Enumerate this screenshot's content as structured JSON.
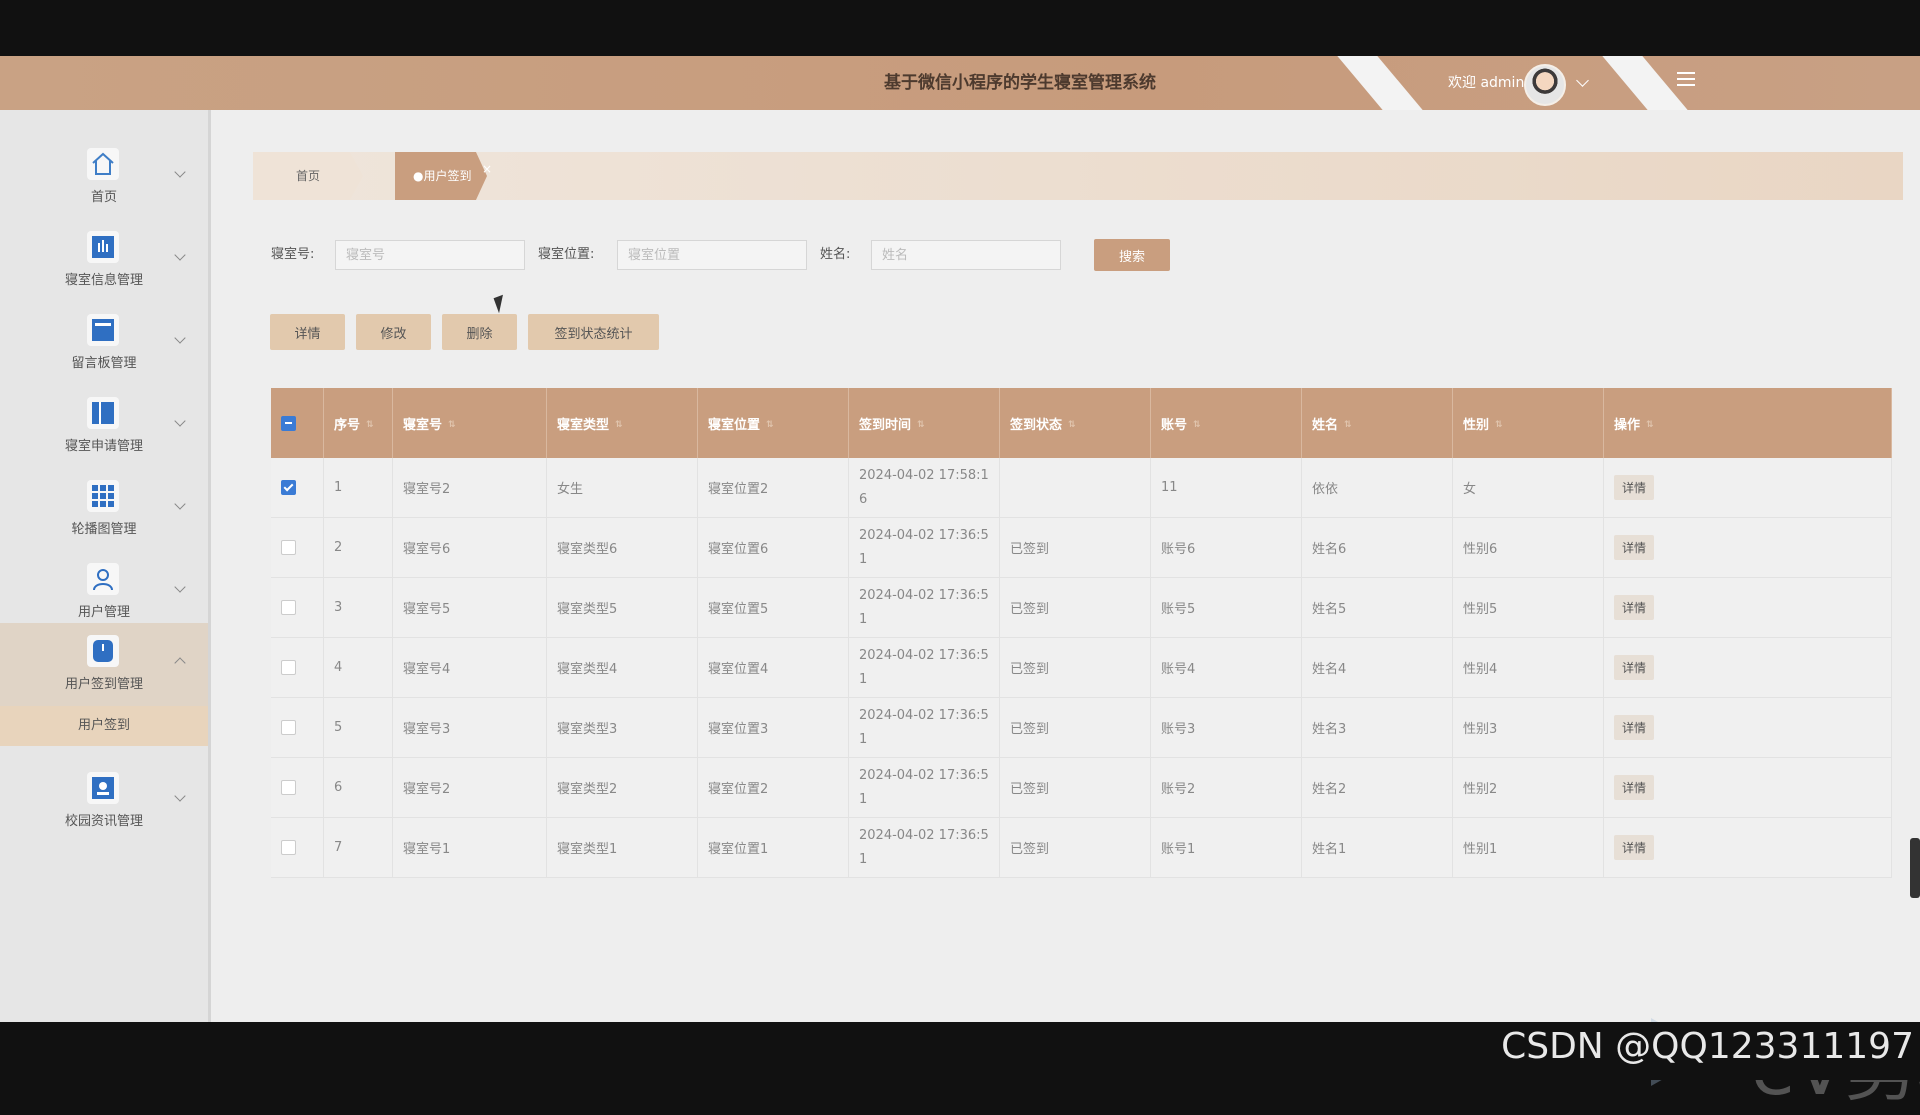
{
  "header": {
    "title": "基于微信小程序的学生寝室管理系统",
    "welcome": "欢迎 admin"
  },
  "sidebar": {
    "items": [
      {
        "label": "首页",
        "icon": "home-icon"
      },
      {
        "label": "寝室信息管理",
        "icon": "info-icon"
      },
      {
        "label": "留言板管理",
        "icon": "board-icon"
      },
      {
        "label": "寝室申请管理",
        "icon": "apply-icon"
      },
      {
        "label": "轮播图管理",
        "icon": "grid-icon"
      },
      {
        "label": "用户管理",
        "icon": "user-icon"
      },
      {
        "label": "用户签到管理",
        "icon": "signin-icon"
      },
      {
        "label": "校园资讯管理",
        "icon": "news-icon"
      }
    ],
    "sub_item": "用户签到"
  },
  "tabs": {
    "home": "首页",
    "active": "●用户签到",
    "close": "×"
  },
  "search": {
    "room_no_label": "寝室号:",
    "room_no_placeholder": "寝室号",
    "room_loc_label": "寝室位置:",
    "room_loc_placeholder": "寝室位置",
    "name_label": "姓名:",
    "name_placeholder": "姓名",
    "search_btn": "搜索"
  },
  "actions": {
    "detail": "详情",
    "edit": "修改",
    "delete": "删除",
    "stats": "签到状态统计"
  },
  "table": {
    "headers": [
      "序号",
      "寝室号",
      "寝室类型",
      "寝室位置",
      "签到时间",
      "签到状态",
      "账号",
      "姓名",
      "性别",
      "操作"
    ],
    "rows": [
      {
        "idx": "1",
        "room": "寝室号2",
        "type": "女生",
        "loc": "寝室位置2",
        "time": "2024-04-02 17:58:16",
        "status": "",
        "account": "11",
        "name": "依依",
        "gender": "女",
        "op": "详情",
        "checked": true
      },
      {
        "idx": "2",
        "room": "寝室号6",
        "type": "寝室类型6",
        "loc": "寝室位置6",
        "time": "2024-04-02 17:36:51",
        "status": "已签到",
        "account": "账号6",
        "name": "姓名6",
        "gender": "性别6",
        "op": "详情",
        "checked": false
      },
      {
        "idx": "3",
        "room": "寝室号5",
        "type": "寝室类型5",
        "loc": "寝室位置5",
        "time": "2024-04-02 17:36:51",
        "status": "已签到",
        "account": "账号5",
        "name": "姓名5",
        "gender": "性别5",
        "op": "详情",
        "checked": false
      },
      {
        "idx": "4",
        "room": "寝室号4",
        "type": "寝室类型4",
        "loc": "寝室位置4",
        "time": "2024-04-02 17:36:51",
        "status": "已签到",
        "account": "账号4",
        "name": "姓名4",
        "gender": "性别4",
        "op": "详情",
        "checked": false
      },
      {
        "idx": "5",
        "room": "寝室号3",
        "type": "寝室类型3",
        "loc": "寝室位置3",
        "time": "2024-04-02 17:36:51",
        "status": "已签到",
        "account": "账号3",
        "name": "姓名3",
        "gender": "性别3",
        "op": "详情",
        "checked": false
      },
      {
        "idx": "6",
        "room": "寝室号2",
        "type": "寝室类型2",
        "loc": "寝室位置2",
        "time": "2024-04-02 17:36:51",
        "status": "已签到",
        "account": "账号2",
        "name": "姓名2",
        "gender": "性别2",
        "op": "详情",
        "checked": false
      },
      {
        "idx": "7",
        "room": "寝室号1",
        "type": "寝室类型1",
        "loc": "寝室位置1",
        "time": "2024-04-02 17:36:51",
        "status": "已签到",
        "account": "账号1",
        "name": "姓名1",
        "gender": "性别1",
        "op": "详情",
        "checked": false
      }
    ]
  },
  "watermark": "eV剪辑",
  "footer_mark": "CSDN @QQ123311197",
  "colors": {
    "accent": "#c99e7f",
    "header": "#c79b7c",
    "checkbox": "#3a7bd5"
  }
}
